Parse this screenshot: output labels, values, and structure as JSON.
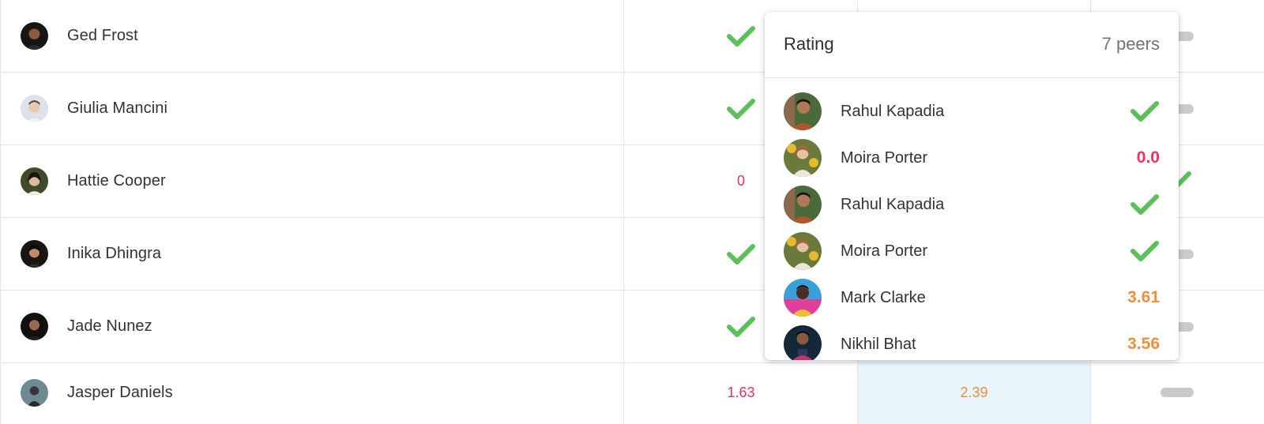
{
  "colors": {
    "check": "#5cc05a",
    "red": "#e8326a",
    "orange": "#f08f3c",
    "dash": "#c9cacc",
    "highlight": "#e6f4fc"
  },
  "rows": [
    {
      "name": "Ged Frost",
      "avatar": "avatar-ged-frost"
    },
    {
      "name": "Giulia Mancini",
      "avatar": "avatar-giulia-mancini"
    },
    {
      "name": "Hattie Cooper",
      "avatar": "avatar-hattie-cooper",
      "col1": "0",
      "col3": "check"
    },
    {
      "name": "Inika Dhingra",
      "avatar": "avatar-inika-dhingra"
    },
    {
      "name": "Jade Nunez",
      "avatar": "avatar-jade-nunez"
    },
    {
      "name": "Jasper Daniels",
      "avatar": "avatar-jasper-daniels",
      "col1": "1.63",
      "col2": "2.39"
    }
  ],
  "popover": {
    "title": "Rating",
    "count": "7 peers",
    "peers": [
      {
        "name": "Rahul Kapadia",
        "value": "check"
      },
      {
        "name": "Moira Porter",
        "value": "0.0"
      },
      {
        "name": "Rahul Kapadia",
        "value": "check"
      },
      {
        "name": "Moira Porter",
        "value": "check"
      },
      {
        "name": "Mark Clarke",
        "value": "3.61"
      },
      {
        "name": "Nikhil Bhat",
        "value": "3.56"
      }
    ]
  }
}
